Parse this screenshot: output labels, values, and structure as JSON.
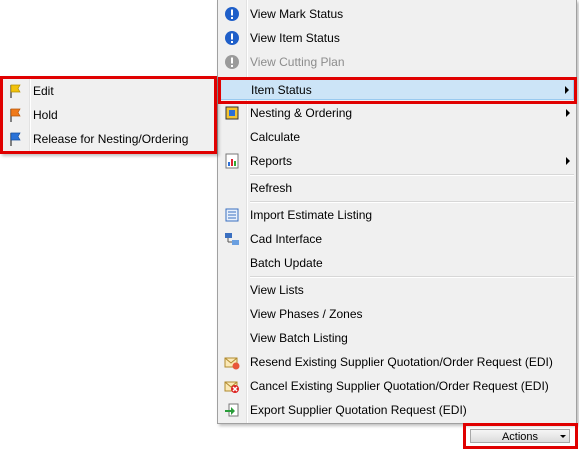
{
  "main_menu": {
    "items": [
      {
        "label": "View Mark Status",
        "icon": "info-blue-icon",
        "disabled": false
      },
      {
        "label": "View Item Status",
        "icon": "info-blue-icon",
        "disabled": false
      },
      {
        "label": "View Cutting Plan",
        "icon": "info-gray-icon",
        "disabled": true
      },
      {
        "label": "Item Status",
        "has_submenu": true,
        "highlighted": true
      },
      {
        "label": "Nesting & Ordering",
        "icon": "nesting-icon",
        "has_submenu": true
      },
      {
        "label": "Calculate"
      },
      {
        "label": "Reports",
        "icon": "reports-icon",
        "has_submenu": true
      },
      {
        "label": "Refresh"
      },
      {
        "label": "Import Estimate Listing",
        "icon": "import-icon"
      },
      {
        "label": "Cad Interface",
        "icon": "cad-icon"
      },
      {
        "label": "Batch Update"
      },
      {
        "label": "View Lists"
      },
      {
        "label": "View Phases / Zones"
      },
      {
        "label": "View Batch Listing"
      },
      {
        "label": "Resend Existing Supplier Quotation/Order Request (EDI)",
        "icon": "resend-mail-icon"
      },
      {
        "label": "Cancel Existing Supplier Quotation/Order Request (EDI)",
        "icon": "cancel-mail-icon"
      },
      {
        "label": "Export Supplier Quotation Request (EDI)",
        "icon": "export-icon"
      }
    ]
  },
  "sub_menu": {
    "items": [
      {
        "label": "Edit",
        "icon": "yellow-flag-icon"
      },
      {
        "label": "Hold",
        "icon": "orange-flag-icon"
      },
      {
        "label": "Release for Nesting/Ordering",
        "icon": "blue-flag-icon"
      }
    ]
  },
  "actions": {
    "label": "Actions"
  },
  "colors": {
    "highlight": "#cce4f7",
    "annotation": "#e00000"
  }
}
